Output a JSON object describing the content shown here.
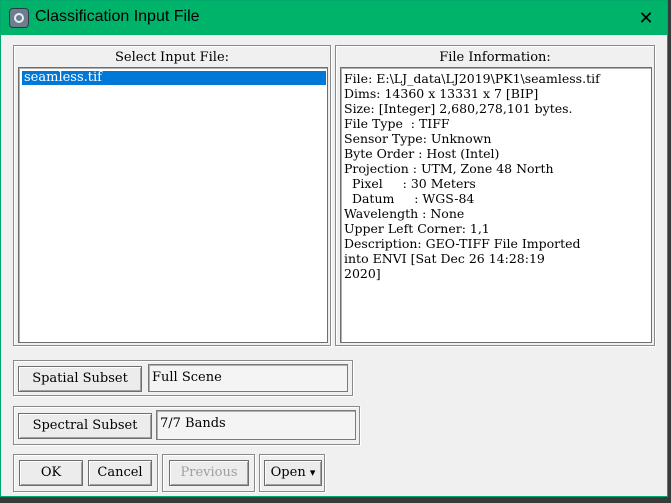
{
  "window": {
    "title": "Classification Input File",
    "close_glyph": "✕"
  },
  "input_panel": {
    "label": "Select Input File:",
    "files": [
      "seamless.tif"
    ]
  },
  "info_panel": {
    "label": "File Information:",
    "lines": [
      "File: E:\\LJ_data\\LJ2019\\PK1\\seamless.tif",
      "Dims: 14360 x 13331 x 7 [BIP]",
      "Size: [Integer] 2,680,278,101 bytes.",
      "File Type  : TIFF",
      "Sensor Type: Unknown",
      "Byte Order : Host (Intel)",
      "Projection : UTM, Zone 48 North",
      "  Pixel     : 30 Meters",
      "  Datum     : WGS-84",
      "Wavelength : None",
      "Upper Left Corner: 1,1",
      "Description: GEO-TIFF File Imported",
      "into ENVI [Sat Dec 26 14:28:19",
      "2020]"
    ]
  },
  "spatial_subset": {
    "button": "Spatial Subset",
    "value": "Full Scene"
  },
  "spectral_subset": {
    "button": "Spectral Subset",
    "value": "7/7 Bands"
  },
  "actions": {
    "ok": "OK",
    "cancel": "Cancel",
    "previous": "Previous",
    "open": "Open",
    "open_arrow": "▾"
  }
}
